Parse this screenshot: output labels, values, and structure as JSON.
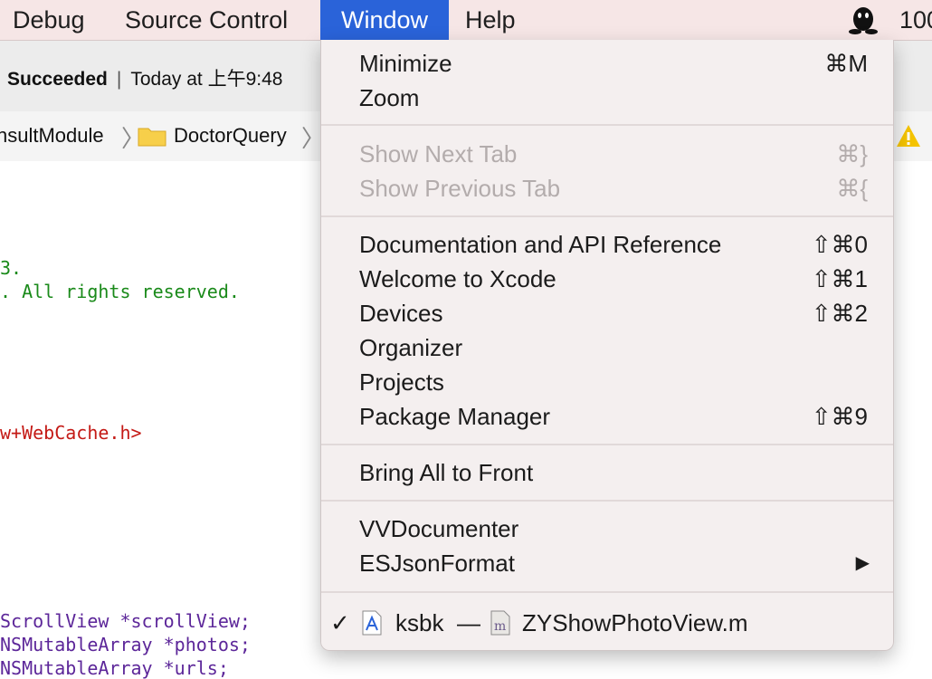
{
  "menubar": {
    "items": [
      "Debug",
      "Source Control",
      "Window",
      "Help"
    ],
    "active": "Window",
    "status_right": "100"
  },
  "status": {
    "result": "Succeeded",
    "separator": "|",
    "time": "Today at 上午9:48"
  },
  "jumpbar": {
    "crumbs": [
      "nsultModule",
      "DoctorQuery"
    ]
  },
  "code": {
    "lines": [
      {
        "text": "3.",
        "color": "green"
      },
      {
        "text": ". All rights reserved.",
        "color": "green"
      },
      {
        "text": "w+WebCache.h>",
        "color": "red"
      },
      {
        "text": "ScrollView *scrollView;",
        "color": "purple"
      },
      {
        "text": "NSMutableArray *photos;",
        "color": "purple"
      },
      {
        "text": "NSMutableArray *urls;",
        "color": "purple"
      }
    ]
  },
  "window_menu": {
    "groups": [
      [
        {
          "label": "Minimize",
          "shortcut": "⌘M",
          "enabled": true
        },
        {
          "label": "Zoom",
          "shortcut": "",
          "enabled": true
        }
      ],
      [
        {
          "label": "Show Next Tab",
          "shortcut": "⌘}",
          "enabled": false
        },
        {
          "label": "Show Previous Tab",
          "shortcut": "⌘{",
          "enabled": false
        }
      ],
      [
        {
          "label": "Documentation and API Reference",
          "shortcut": "⇧⌘0",
          "enabled": true
        },
        {
          "label": "Welcome to Xcode",
          "shortcut": "⇧⌘1",
          "enabled": true
        },
        {
          "label": "Devices",
          "shortcut": "⇧⌘2",
          "enabled": true
        },
        {
          "label": "Organizer",
          "shortcut": "",
          "enabled": true
        },
        {
          "label": "Projects",
          "shortcut": "",
          "enabled": true
        },
        {
          "label": "Package Manager",
          "shortcut": "⇧⌘9",
          "enabled": true
        }
      ],
      [
        {
          "label": "Bring All to Front",
          "shortcut": "",
          "enabled": true
        }
      ],
      [
        {
          "label": "VVDocumenter",
          "shortcut": "",
          "enabled": true
        },
        {
          "label": "ESJsonFormat",
          "shortcut": "▶",
          "enabled": true
        }
      ]
    ],
    "workspace_item": {
      "check": "✓",
      "project": "ksbk",
      "dash": "—",
      "file": "ZYShowPhotoView.m"
    }
  },
  "colors": {
    "menu_highlight": "#2a63d9",
    "comment_green": "#1a8a1a",
    "string_red": "#c41a16",
    "type_purple": "#5c2699",
    "warning_yellow": "#f5c400"
  },
  "icons": [
    "qq-penguin-icon",
    "folder-icon",
    "warning-icon",
    "checkmark-icon",
    "xcode-project-icon",
    "objc-file-icon",
    "submenu-arrow-icon"
  ]
}
